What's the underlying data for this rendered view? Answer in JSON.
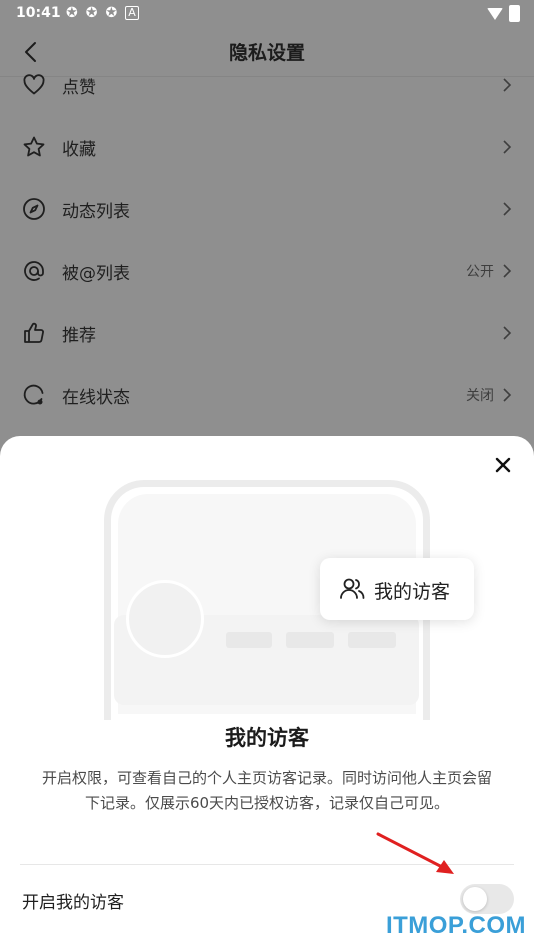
{
  "status_bar": {
    "time": "10:41",
    "icons": [
      "notification-icon",
      "notification-icon",
      "notification-icon",
      "a-icon"
    ],
    "right_icons": [
      "wifi-icon",
      "battery-icon"
    ]
  },
  "header": {
    "title": "隐私设置",
    "back_icon": "back-chevron-icon"
  },
  "settings": [
    {
      "label": "点赞",
      "icon": "heart-icon",
      "value": ""
    },
    {
      "label": "收藏",
      "icon": "star-icon",
      "value": ""
    },
    {
      "label": "动态列表",
      "icon": "compass-icon",
      "value": ""
    },
    {
      "label": "被@列表",
      "icon": "at-icon",
      "value": "公开"
    },
    {
      "label": "推荐",
      "icon": "thumbs-up-icon",
      "value": ""
    },
    {
      "label": "在线状态",
      "icon": "online-status-icon",
      "value": "关闭"
    }
  ],
  "sheet": {
    "close_icon": "close-icon",
    "chip_label": "我的访客",
    "chip_icon": "users-icon",
    "title": "我的访客",
    "description": "开启权限，可查看自己的个人主页访客记录。同时访问他人主页会留下记录。仅展示60天内已授权访客，记录仅自己可见。",
    "toggle_label": "开启我的访客",
    "toggle_on": false
  },
  "watermark": "ITMOP.COM",
  "colors": {
    "overlay": "#8f8f8f",
    "annotation_arrow": "#e02020",
    "watermark": "#3a9fd8"
  }
}
